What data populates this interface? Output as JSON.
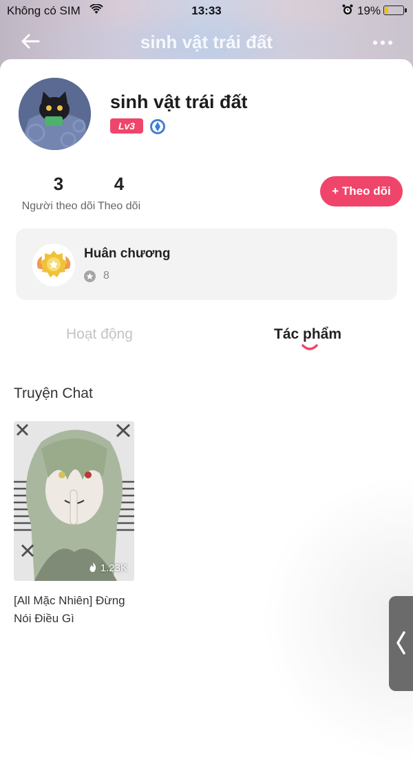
{
  "status_bar": {
    "carrier": "Không có SIM",
    "time": "13:33",
    "battery_percent": "19%",
    "battery_level": 0.19,
    "icons": [
      "wifi-icon",
      "alarm-icon",
      "battery-icon"
    ]
  },
  "nav": {
    "title": "sinh vật trái đất",
    "back_icon": "back-arrow-icon",
    "more_icon": "more-dots-icon"
  },
  "profile": {
    "name": "sinh vật trái đất",
    "level": "Lv3",
    "verify_icon": "verified-badge-icon",
    "avatar": "cat-avatar"
  },
  "stats": {
    "followers_count": "3",
    "followers_label": "Người theo dõi",
    "following_count": "4",
    "following_label": "Theo dõi"
  },
  "follow_button": {
    "label": "+ Theo dõi"
  },
  "medal": {
    "title": "Huân chương",
    "count": "8",
    "icon": "medal-icon"
  },
  "tabs": [
    {
      "label": "Hoạt động",
      "active": false
    },
    {
      "label": "Tác phẩm",
      "active": true
    }
  ],
  "section": {
    "title": "Truyện Chat"
  },
  "stories": [
    {
      "views": "1.23K",
      "title": "[All Mặc Nhiên] Đừng Nói Điều Gì",
      "icon": "flame-icon"
    }
  ],
  "side_handle": {
    "icon": "chevron-left-icon"
  },
  "colors": {
    "accent": "#f0456a",
    "text": "#222222",
    "muted": "#888888",
    "card_bg": "#f3f3f3"
  }
}
